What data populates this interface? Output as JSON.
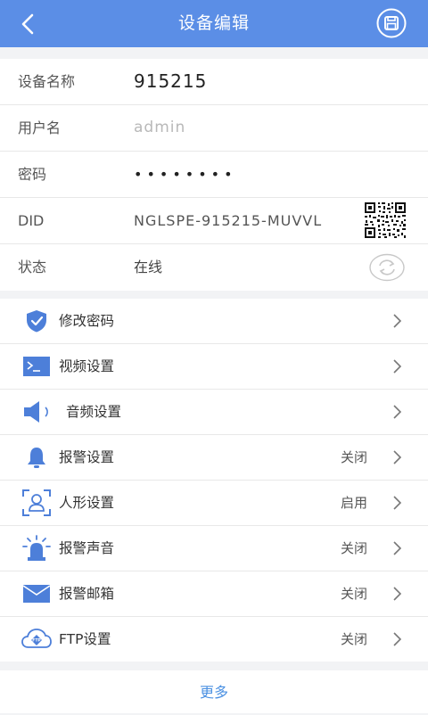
{
  "header": {
    "title": "设备编辑",
    "back_icon": "chevron-left-icon",
    "save_icon": "save-icon",
    "color": "#5b8ee6"
  },
  "device": {
    "name_label": "设备名称",
    "name_value": "915215",
    "user_label": "用户名",
    "user_value": "admin",
    "password_label": "密码",
    "password_value": "••••••••",
    "did_label": "DID",
    "did_value": "NGLSPE-915215-MUVVL",
    "status_label": "状态",
    "status_value": "在线"
  },
  "menu": [
    {
      "label": "修改密码",
      "status": "",
      "icon": "shield-check-icon"
    },
    {
      "label": "视频设置",
      "status": "",
      "icon": "video-terminal-icon"
    },
    {
      "label": "音频设置",
      "status": "",
      "icon": "speaker-icon"
    },
    {
      "label": "报警设置",
      "status": "关闭",
      "icon": "bell-icon"
    },
    {
      "label": "人形设置",
      "status": "启用",
      "icon": "person-detect-icon"
    },
    {
      "label": "报警声音",
      "status": "关闭",
      "icon": "alarm-siren-icon"
    },
    {
      "label": "报警邮箱",
      "status": "关闭",
      "icon": "envelope-icon"
    },
    {
      "label": "FTP设置",
      "status": "关闭",
      "icon": "ftp-cloud-icon"
    }
  ],
  "footer": {
    "more_label": "更多"
  }
}
